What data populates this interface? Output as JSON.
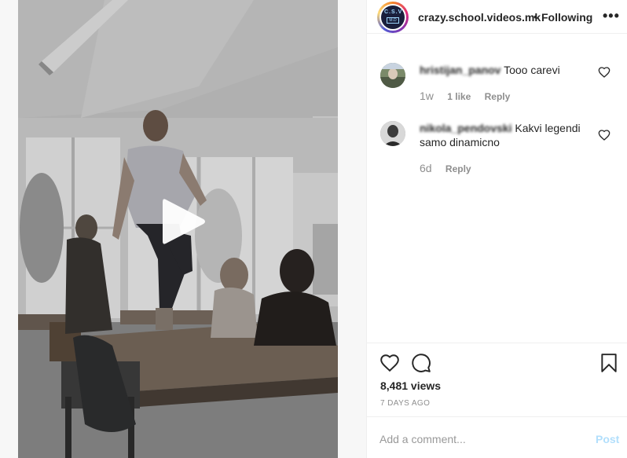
{
  "post": {
    "username": "crazy.school.videos.mk",
    "separator": "•",
    "follow_status": "Following",
    "more_label": "•••",
    "avatar_text": "C.S.V",
    "avatar_subtext": "M.D"
  },
  "comments": [
    {
      "username": "hristijan_panov",
      "text": "Tooo carevi",
      "time": "1w",
      "likes": "1 like",
      "reply": "Reply"
    },
    {
      "username": "nikola_pendovski",
      "text": "Kakvi legendi samo dinamicno",
      "time": "6d",
      "reply": "Reply"
    }
  ],
  "stats": {
    "views": "8,481 views",
    "posted_ago": "7 DAYS AGO"
  },
  "composer": {
    "placeholder": "Add a comment...",
    "post_label": "Post"
  },
  "colors": {
    "text": "#262626",
    "muted": "#8e8e8e",
    "post_disabled": "#b2dffc",
    "border": "#efefef"
  },
  "icons": {
    "like": "heart-icon",
    "comment": "speech-bubble-icon",
    "save": "bookmark-icon",
    "play": "play-icon"
  }
}
